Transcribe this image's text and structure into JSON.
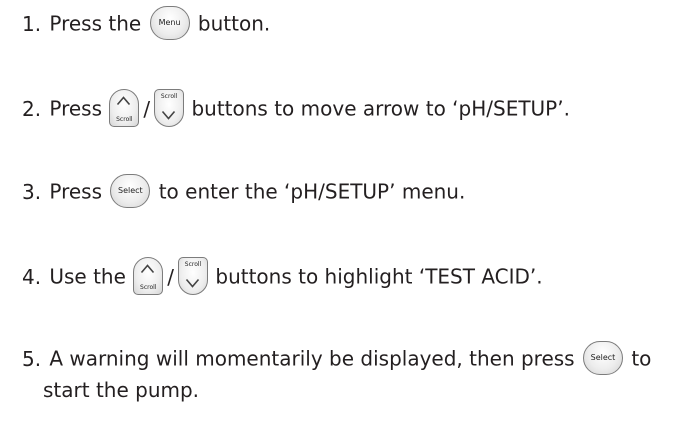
{
  "buttons": {
    "menu": "Menu",
    "select": "Select",
    "scroll": "Scroll"
  },
  "steps": [
    {
      "num": "1.",
      "a": "Press the",
      "b": "button."
    },
    {
      "num": "2.",
      "a": "Press",
      "slash": "/",
      "b": "buttons to move arrow to ‘pH/SETUP’."
    },
    {
      "num": "3.",
      "a": "Press",
      "b": "to enter the ‘pH/SETUP’ menu."
    },
    {
      "num": "4.",
      "a": "Use the",
      "slash": "/",
      "b": "buttons to highlight ‘TEST ACID’."
    },
    {
      "num": "5.",
      "a": "A warning will momentarily be displayed, then press",
      "b": "to",
      "c": "start the pump."
    }
  ]
}
